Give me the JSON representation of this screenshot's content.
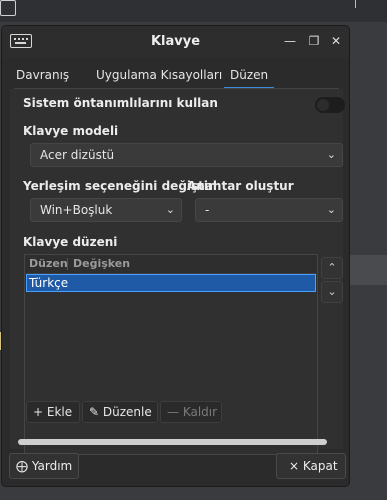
{
  "window": {
    "title": "Klavye"
  },
  "tabs": [
    {
      "label": "Davranış",
      "active": false
    },
    {
      "label": "Uygulama Kısayolları",
      "active": false
    },
    {
      "label": "Düzen",
      "active": true
    }
  ],
  "settings": {
    "use_defaults_label": "Sistem öntanımlılarını kullan",
    "use_defaults_on": false,
    "keyboard_model_label": "Klavye modeli",
    "keyboard_model_value": "Acer dizüstü",
    "switch_layout_label": "Yerleşim seçeneğini değiştir",
    "switch_layout_value": "Win+Boşluk",
    "compose_key_label": "Anahtar oluştur",
    "compose_key_value": "-"
  },
  "layout_list": {
    "label": "Klavye düzeni",
    "columns": [
      "Düzen",
      "Değişken"
    ],
    "rows": [
      {
        "layout": "Türkçe",
        "variant": "",
        "selected": true
      }
    ]
  },
  "toolbar": {
    "add": "Ekle",
    "edit": "Düzenle",
    "remove": "Kaldır"
  },
  "footer": {
    "help": "Yardım",
    "close": "Kapat"
  },
  "icons": {
    "app": "keyboard-icon",
    "add": "plus-icon",
    "edit": "pencil-icon",
    "remove": "minus-icon",
    "help": "lifebuoy-icon",
    "close": "close-icon"
  },
  "colors": {
    "accent": "#3c8ad8",
    "selection": "#1f5aa6",
    "window_bg": "#2b2b2b"
  }
}
